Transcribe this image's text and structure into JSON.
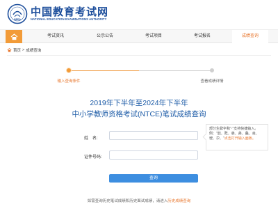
{
  "header": {
    "title": "中国教育考试网",
    "subtitle": "NATIONAL EDUCATION EXAMINATIONS AUTHORITY",
    "emblem_text": "NEEA"
  },
  "nav": {
    "items": [
      {
        "label": "考试资讯"
      },
      {
        "label": "公示公告"
      },
      {
        "label": "考试项目"
      },
      {
        "label": "考试报名"
      },
      {
        "label": "成绩查询"
      }
    ],
    "active_index": 4,
    "accent": "#f29b38"
  },
  "breadcrumb": {
    "home": "首页",
    "separator": ">",
    "current": "成绩查询"
  },
  "steps": [
    {
      "label": "输入查询条件",
      "state": "active"
    },
    {
      "label": "查看成绩详情",
      "state": "pending"
    }
  ],
  "title": {
    "line1": "2019年下半年至2024年下半年",
    "line2": "中小学教师资格考试(NTCE)笔试成绩查询"
  },
  "form": {
    "name_label": "姓　名:",
    "name_value": "",
    "id_label": "证件号码:",
    "id_value": "",
    "submit_label": "查询"
  },
  "tip": {
    "text": "部分生僻字和\"·\"支持快捷输入。例：\"喆、甦、犇、羴、鱻、垚、瑷、尕、\"",
    "link": "点击打开输入面板。"
  },
  "footer": {
    "text": "如需查询历史笔试成绩和历史面试成绩，请进入",
    "link": "历史成绩查询"
  },
  "colors": {
    "brand_blue": "#1e4f9c",
    "title_blue": "#1b5aa6",
    "orange": "#e8772e",
    "button_blue": "#3d8ee0"
  }
}
